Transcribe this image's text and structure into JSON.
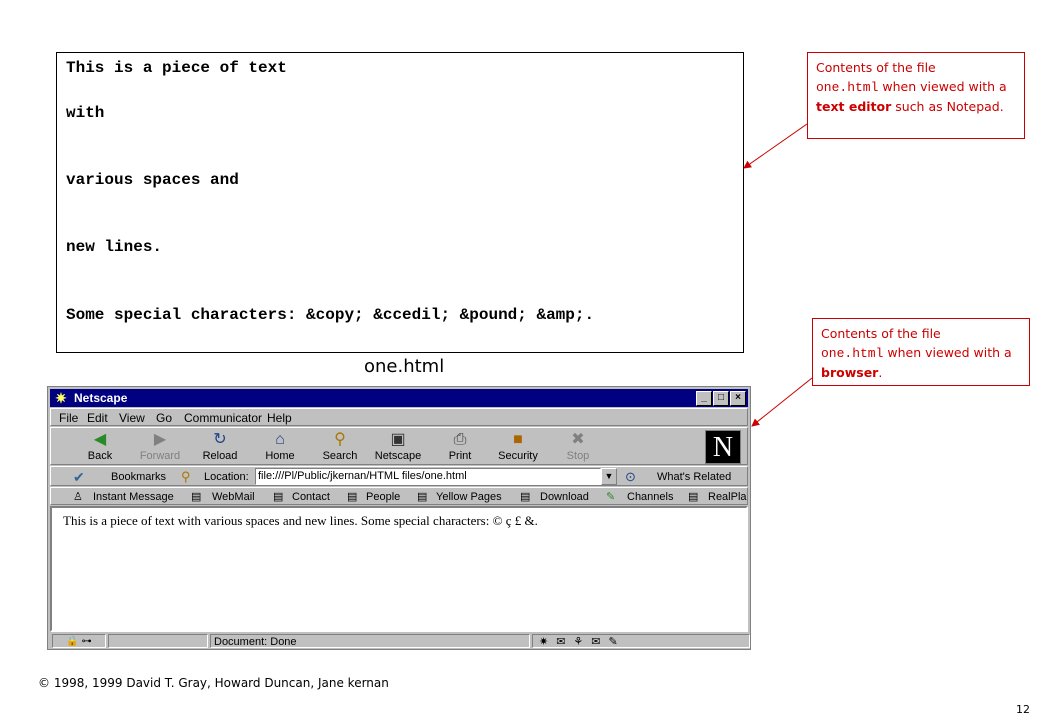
{
  "source_file": {
    "lines": [
      "This is a piece of text",
      "with",
      "various spaces and",
      "new lines.",
      "Some special characters: &copy; &ccedil; &pound; &amp;."
    ],
    "caption": "one.html"
  },
  "callout_editor": {
    "prefix": "Contents of the file",
    "filename": "one.html",
    "mid": " when viewed with a ",
    "emph": "text editor",
    "suffix": " such as Notepad."
  },
  "callout_browser": {
    "prefix": "Contents of the file",
    "filename": "one.html",
    "mid": " when viewed with a ",
    "emph": "browser",
    "suffix": "."
  },
  "browser": {
    "title": "Netscape",
    "menu": [
      "File",
      "Edit",
      "View",
      "Go",
      "Communicator",
      "Help"
    ],
    "nav": [
      {
        "label": "Back",
        "icon": "back-arrow-icon",
        "glyph": "◀",
        "enabled": true
      },
      {
        "label": "Forward",
        "icon": "forward-arrow-icon",
        "glyph": "▶",
        "enabled": false
      },
      {
        "label": "Reload",
        "icon": "reload-icon",
        "glyph": "↻",
        "enabled": true
      },
      {
        "label": "Home",
        "icon": "home-icon",
        "glyph": "⌂",
        "enabled": true
      },
      {
        "label": "Search",
        "icon": "search-icon",
        "glyph": "⚲",
        "enabled": true
      },
      {
        "label": "Netscape",
        "icon": "netscape-icon",
        "glyph": "▣",
        "enabled": true
      },
      {
        "label": "Print",
        "icon": "printer-icon",
        "glyph": "⎙",
        "enabled": true
      },
      {
        "label": "Security",
        "icon": "lock-icon",
        "glyph": "🔒",
        "enabled": true
      },
      {
        "label": "Stop",
        "icon": "stop-icon",
        "glyph": "✖",
        "enabled": false
      }
    ],
    "location_bar": {
      "bookmarks": "Bookmarks",
      "location_label": "Location:",
      "url": "file:///Pl/Public/jkernan/HTML files/one.html",
      "whats_related": "What's Related"
    },
    "personal_toolbar": [
      "Instant Message",
      "WebMail",
      "Contact",
      "People",
      "Yellow Pages",
      "Download",
      "Channels",
      "RealPla"
    ],
    "page_text": "This is a piece of text with various spaces and new lines. Some special characters: © ç £ &.",
    "status": "Document: Done"
  },
  "footer": {
    "copyright": "© 1998, 1999 David T. Gray, Howard Duncan, Jane kernan",
    "page_number": "12"
  },
  "colors": {
    "callout": "#cc0000",
    "titlebar": "#000080",
    "chrome": "#c0c0c0"
  }
}
